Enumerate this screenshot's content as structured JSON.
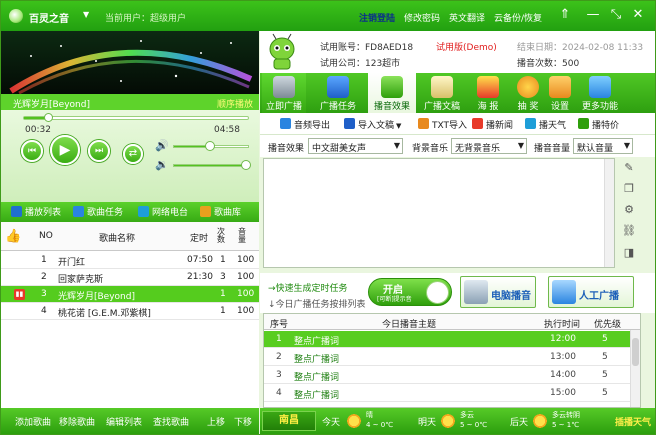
{
  "titlebar": {
    "app_name": "百灵之音",
    "current_user": "当前用户：超级用户",
    "links": [
      "注销登陆",
      "修改密码",
      "英文翻译",
      "云备份/恢复"
    ]
  },
  "player": {
    "now_playing": "光辉岁月[Beyond]",
    "play_mode": "顺序播放",
    "time_current": "00:32",
    "time_total": "04:58",
    "progress": 0.11,
    "volume1": 0.48,
    "volume2": 0.95
  },
  "left_tabs": [
    "播放列表",
    "歌曲任务",
    "网络电台",
    "歌曲库"
  ],
  "song_table": {
    "headers": {
      "no": "NO",
      "name": "歌曲名称",
      "time": "定时",
      "count": "次数",
      "vol": "音量"
    },
    "rows": [
      {
        "no": "1",
        "name": "开门红",
        "time": "07:50",
        "count": "1",
        "vol": "100"
      },
      {
        "no": "2",
        "name": "回家萨克斯",
        "time": "21:30",
        "count": "3",
        "vol": "100"
      },
      {
        "no": "3",
        "name": "光辉岁月[Beyond]",
        "time": "",
        "count": "1",
        "vol": "100"
      },
      {
        "no": "4",
        "name": "桃花诺 [G.E.M.邓紫棋]",
        "time": "",
        "count": "1",
        "vol": "100"
      }
    ]
  },
  "left_bottom": [
    "添加歌曲",
    "移除歌曲",
    "编辑列表",
    "查找歌曲",
    "上移",
    "下移"
  ],
  "account": {
    "account_label": "试用账号：FD8AED18",
    "version": "试用版(Demo)",
    "expire": "结束日期：2024-02-08 11:33",
    "company": "试用公司：123超市",
    "times": "播音次数：500"
  },
  "toolbar": [
    "立即广播",
    "广播任务",
    "播音效果",
    "广播文稿",
    "海 报",
    "抽 奖",
    "设置",
    "更多功能"
  ],
  "sub_toolbar": [
    "音频导出",
    "导入文稿",
    "TXT导入",
    "播新闻",
    "播天气",
    "播特价"
  ],
  "selectors": {
    "effect_label": "播音效果",
    "effect_value": "中文甜美女声",
    "bgm_label": "背景音乐",
    "bgm_value": "无背景音乐",
    "vol_label": "播音音量",
    "vol_value": "默认音量"
  },
  "quick": {
    "generate": "→快速生成定时任务",
    "today": "↓今日广播任务按排列表",
    "toggle_on": "开启",
    "toggle_sub": "[可断]提示音",
    "pc_play": "电脑播音",
    "manual": "人工广播"
  },
  "task_table": {
    "headers": {
      "no": "序号",
      "topic": "今日播音主题",
      "time": "执行时间",
      "priority": "优先级"
    },
    "rows": [
      {
        "no": "1",
        "topic": "整点广播词",
        "time": "12:00",
        "priority": "5"
      },
      {
        "no": "2",
        "topic": "整点广播词",
        "time": "13:00",
        "priority": "5"
      },
      {
        "no": "3",
        "topic": "整点广播词",
        "time": "14:00",
        "priority": "5"
      },
      {
        "no": "4",
        "topic": "整点广播词",
        "time": "15:00",
        "priority": "5"
      }
    ]
  },
  "weather": {
    "city": "南昌",
    "today": "今天",
    "today_desc": "晴",
    "today_temp": "4 ~ 0℃",
    "tomorrow": "明天",
    "tomorrow_desc": "多云",
    "tomorrow_temp": "5 ~ 0℃",
    "after": "后天",
    "after_desc": "多云转阴",
    "after_temp": "5 ~ 1℃",
    "link": "插播天气"
  },
  "colors": {
    "accent": "#3cc21a",
    "active_row": "#55cc1e",
    "login_link": "#0a2f8a",
    "demo_red": "#e11e1e"
  }
}
